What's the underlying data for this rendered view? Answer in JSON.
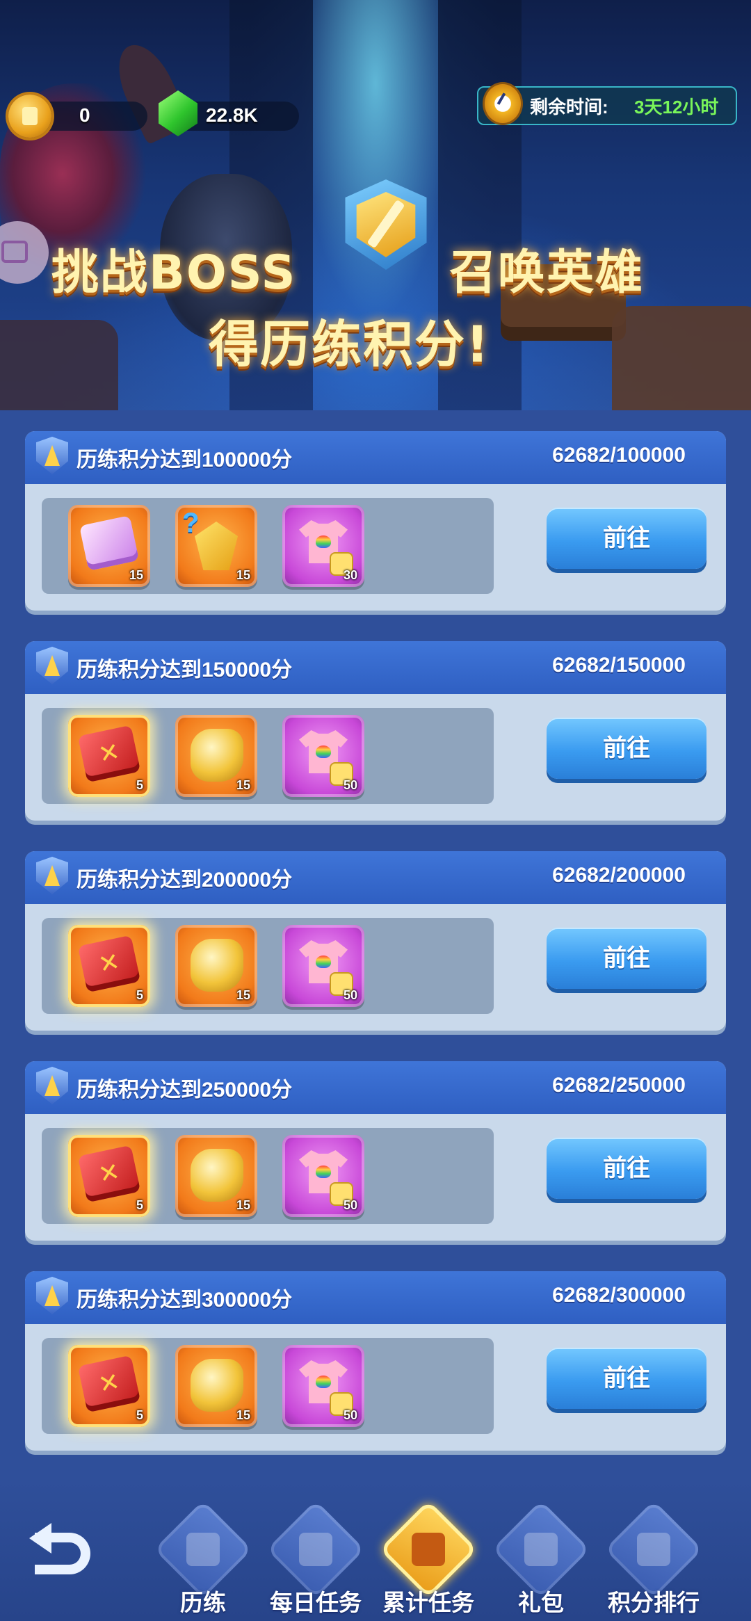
{
  "header": {
    "medal_count": "0",
    "gem_count": "22.8K",
    "timer_label": "剩余时间:",
    "timer_value": "3天12小时",
    "banner_line1_left": "挑战BOSS",
    "banner_line1_right": "召唤英雄",
    "banner_line2": "得历练积分!"
  },
  "tasks": [
    {
      "title": "历练积分达到100000分",
      "progress": "62682/100000",
      "button": "前往",
      "rewards": [
        {
          "icon": "purple-scroll-icon",
          "qty": "15"
        },
        {
          "icon": "mystery-crystal-icon",
          "qty": "15"
        },
        {
          "icon": "rainbow-shirt-shard-icon",
          "qty": "30"
        }
      ]
    },
    {
      "title": "历练积分达到150000分",
      "progress": "62682/150000",
      "button": "前往",
      "rewards": [
        {
          "icon": "red-scroll-icon",
          "qty": "5"
        },
        {
          "icon": "gold-ore-icon",
          "qty": "15"
        },
        {
          "icon": "rainbow-shirt-shard-icon",
          "qty": "50"
        }
      ]
    },
    {
      "title": "历练积分达到200000分",
      "progress": "62682/200000",
      "button": "前往",
      "rewards": [
        {
          "icon": "red-scroll-icon",
          "qty": "5"
        },
        {
          "icon": "gold-ore-icon",
          "qty": "15"
        },
        {
          "icon": "rainbow-shirt-shard-icon",
          "qty": "50"
        }
      ]
    },
    {
      "title": "历练积分达到250000分",
      "progress": "62682/250000",
      "button": "前往",
      "rewards": [
        {
          "icon": "red-scroll-icon",
          "qty": "5"
        },
        {
          "icon": "gold-ore-icon",
          "qty": "15"
        },
        {
          "icon": "rainbow-shirt-shard-icon",
          "qty": "50"
        }
      ]
    },
    {
      "title": "历练积分达到300000分",
      "progress": "62682/300000",
      "button": "前往",
      "rewards": [
        {
          "icon": "red-scroll-icon",
          "qty": "5"
        },
        {
          "icon": "gold-ore-icon",
          "qty": "15"
        },
        {
          "icon": "rainbow-shirt-shard-icon",
          "qty": "50"
        }
      ]
    }
  ],
  "nav": {
    "items": [
      {
        "label": "历练",
        "active": false
      },
      {
        "label": "每日任务",
        "active": false
      },
      {
        "label": "累计任务",
        "active": true
      },
      {
        "label": "礼包",
        "active": false
      },
      {
        "label": "积分排行",
        "active": false
      }
    ]
  },
  "colors": {
    "background": "#2f4f9a",
    "card_header": "#3f75d8",
    "button": "#3a9bf0",
    "timer_value": "#79f55a",
    "active_tab": "#e99a16"
  }
}
